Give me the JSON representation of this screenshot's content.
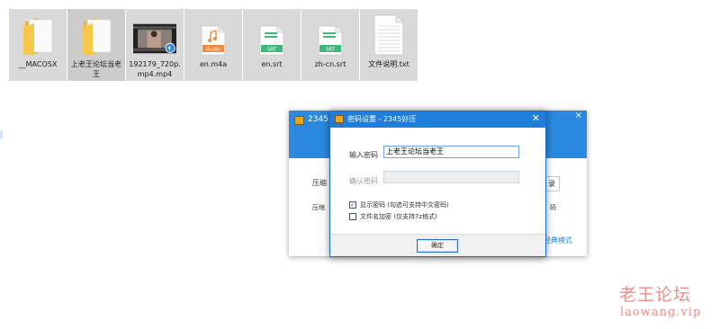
{
  "files": [
    {
      "name": "__MACOSX",
      "type": "folder",
      "selected": true
    },
    {
      "name": "上老王论坛当老王",
      "type": "folder",
      "selected": true
    },
    {
      "name": "192179_720p.mp4.mp4",
      "type": "video",
      "selected": true
    },
    {
      "name": "en.m4a",
      "type": "audio",
      "icon_label": "Audio",
      "selected": true
    },
    {
      "name": "en.srt",
      "type": "subtitle",
      "icon_label": "SRT",
      "selected": true
    },
    {
      "name": "zh-cn.srt",
      "type": "subtitle",
      "icon_label": "SRT",
      "selected": true
    },
    {
      "name": "文件说明.txt",
      "type": "text",
      "selected": true
    }
  ],
  "app_window": {
    "title": "2345",
    "close": "×",
    "label1": "压缩",
    "label2": "压缩",
    "button_partial": "录",
    "right_text": "码",
    "link_partial": "经典模式"
  },
  "dialog": {
    "title": "密码设置 - 2345好压",
    "close": "✕",
    "enter_password_label": "输入密码",
    "enter_password_value": "上老王论坛当老王",
    "confirm_password_label": "确认密码",
    "confirm_password_value": "",
    "show_password": {
      "label": "显示密码 (勾选可支持中文密码)",
      "checked": true,
      "mark": "✓"
    },
    "encrypt_filenames": {
      "label": "文件名加密 (仅支持7z格式)",
      "checked": false
    },
    "ok_button": "确定"
  },
  "watermark": {
    "title": "老王论坛",
    "url": "laowang.vip"
  },
  "colors": {
    "titlebar_blue": "#1f7ed9",
    "folder_yellow": "#f5c84c",
    "audio_orange": "#f08a3c",
    "srt_green": "#3cb878",
    "watermark": "#f28b8b"
  }
}
